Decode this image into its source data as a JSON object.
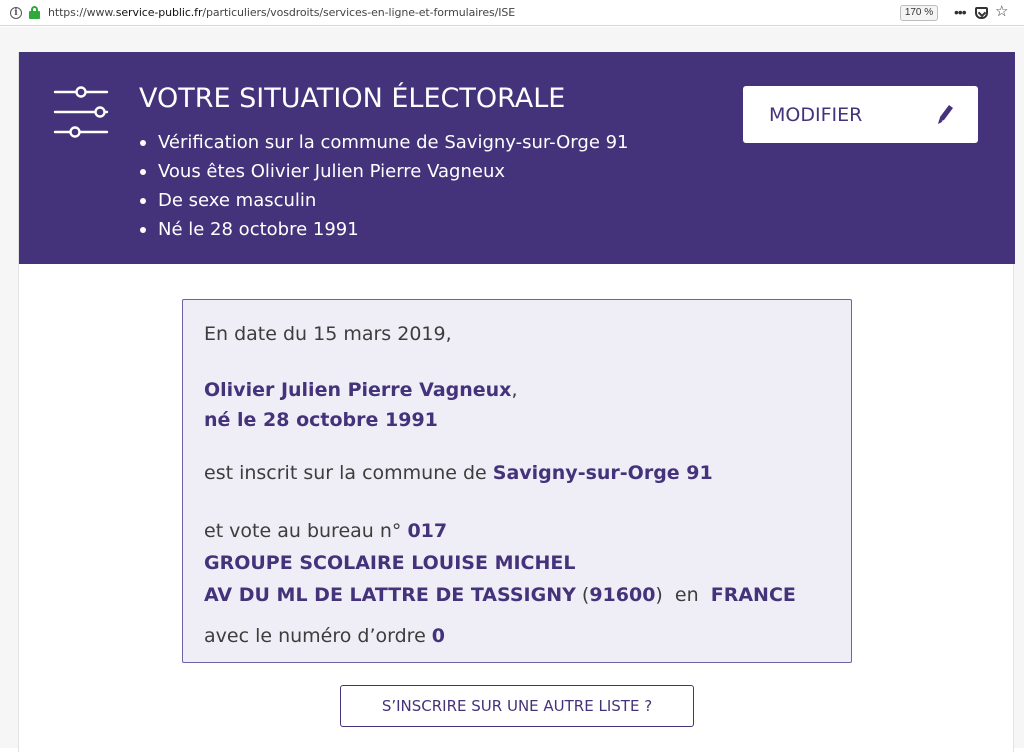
{
  "browser": {
    "url_prefix": "https://www.",
    "url_host": "service-public.fr",
    "url_path": "/particuliers/vosdroits/services-en-ligne-et-formulaires/ISE",
    "zoom": "170 %",
    "icons": {
      "info": "info-icon",
      "lock": "lock-icon",
      "more": "more-icon",
      "pocket": "pocket-icon",
      "bookmark": "star-icon"
    }
  },
  "banner": {
    "title": "VOTRE SITUATION ÉLECTORALE",
    "icon": "sliders-icon",
    "items": [
      "Vérification sur la commune de Savigny-sur-Orge 91",
      "Vous êtes Olivier Julien Pierre Vagneux",
      "De sexe masculin",
      "Né le 28 octobre 1991"
    ],
    "modify_label": "MODIFIER",
    "modify_icon": "pencil-icon"
  },
  "result": {
    "date_line": "En date du 15 mars 2019,",
    "name": "Olivier Julien Pierre Vagneux",
    "name_suffix": ",",
    "birth": "né le 28 octobre 1991",
    "registered_prefix": "est inscrit sur la commune de ",
    "commune": "Savigny-sur-Orge 91",
    "bureau_prefix": "et vote au bureau n° ",
    "bureau_number": "017",
    "bureau_name": "GROUPE SCOLAIRE LOUISE MICHEL",
    "address": "AV DU ML DE LATTRE DE TASSIGNY",
    "paren_open": " (",
    "postal_code": "91600",
    "paren_close": ")",
    "country_prefix": "  en  ",
    "country": "FRANCE",
    "order_prefix": "avec le numéro d’ordre ",
    "order_number": "0"
  },
  "other_list_label": "S’INSCRIRE SUR UNE AUTRE LISTE ?",
  "colors": {
    "brand": "#44337a",
    "box_bg": "#efeef6",
    "box_border": "#6b63a3",
    "lock_green": "#2eaa3c"
  }
}
